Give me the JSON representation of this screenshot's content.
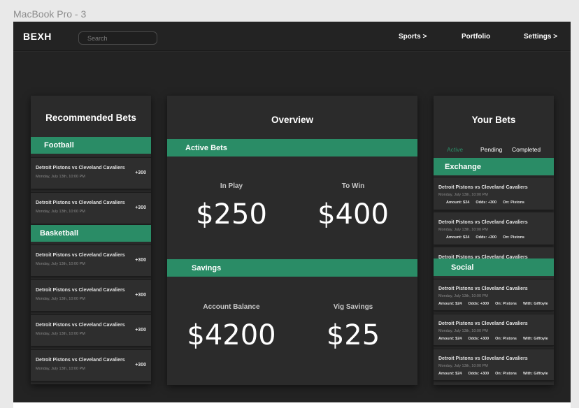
{
  "frame_label": "MacBook Pro - 3",
  "header": {
    "logo": "BEXH",
    "search_placeholder": "Search",
    "nav": [
      "Sports >",
      "Portfolio",
      "Settings >"
    ]
  },
  "recommended": {
    "title": "Recommended Bets",
    "sections": [
      {
        "label": "Football",
        "bets": [
          {
            "title": "Detroit Pistons vs Cleveland Cavaliers",
            "date": "Monday, July 13th, 10:00 PM",
            "odds": "+300"
          },
          {
            "title": "Detroit Pistons vs Cleveland Cavaliers",
            "date": "Monday, July 13th, 10:00 PM",
            "odds": "+300"
          }
        ]
      },
      {
        "label": "Basketball",
        "bets": [
          {
            "title": "Detroit Pistons vs Cleveland Cavaliers",
            "date": "Monday, July 13th, 10:00 PM",
            "odds": "+300"
          },
          {
            "title": "Detroit Pistons vs Cleveland Cavaliers",
            "date": "Monday, July 13th, 10:00 PM",
            "odds": "+300"
          },
          {
            "title": "Detroit Pistons vs Cleveland Cavaliers",
            "date": "Monday, July 13th, 10:00 PM",
            "odds": "+300"
          },
          {
            "title": "Detroit Pistons vs Cleveland Cavaliers",
            "date": "Monday, July 13th, 10:00 PM",
            "odds": "+300"
          }
        ]
      }
    ]
  },
  "overview": {
    "title": "Overview",
    "active_bets": {
      "label": "Active Bets",
      "in_play_label": "In Play",
      "in_play_value": "$250",
      "to_win_label": "To Win",
      "to_win_value": "$400"
    },
    "savings": {
      "label": "Savings",
      "balance_label": "Account Balance",
      "balance_value": "$4200",
      "vig_label": "Vig Savings",
      "vig_value": "$25"
    }
  },
  "your_bets": {
    "title": "Your Bets",
    "tabs": [
      "Active",
      "Pending",
      "Completed"
    ],
    "active_tab": "Active",
    "exchange": {
      "label": "Exchange",
      "bets": [
        {
          "title": "Detroit Pistons vs Cleveland Cavaliers",
          "date": "Monday, July 13th, 10:00 PM",
          "amount": "Amount: $24",
          "odds": "Odds: +300",
          "on": "On: Pistons"
        },
        {
          "title": "Detroit Pistons vs Cleveland Cavaliers",
          "date": "Monday, July 13th, 10:00 PM",
          "amount": "Amount: $24",
          "odds": "Odds: +300",
          "on": "On: Pistons"
        },
        {
          "title": "Detroit Pistons vs Cleveland Cavaliers",
          "date": "",
          "amount": "",
          "odds": "",
          "on": ""
        }
      ]
    },
    "social": {
      "label": "Social",
      "bets": [
        {
          "title": "Detroit Pistons vs Cleveland Cavaliers",
          "date": "Monday, July 13th, 10:00 PM",
          "amount": "Amount: $24",
          "odds": "Odds: +300",
          "on": "On: Pistons",
          "with": "With: Giffoyle"
        },
        {
          "title": "Detroit Pistons vs Cleveland Cavaliers",
          "date": "Monday, July 13th, 10:00 PM",
          "amount": "Amount: $24",
          "odds": "Odds: +300",
          "on": "On: Pistons",
          "with": "With: Giffoyle"
        },
        {
          "title": "Detroit Pistons vs Cleveland Cavaliers",
          "date": "Monday, July 13th, 10:00 PM",
          "amount": "Amount: $24",
          "odds": "Odds: +300",
          "on": "On: Pistons",
          "with": "With: Giffoyle"
        }
      ]
    }
  },
  "colors": {
    "accent": "#2a8c66",
    "background": "#232323",
    "panel": "#2b2b2b"
  }
}
